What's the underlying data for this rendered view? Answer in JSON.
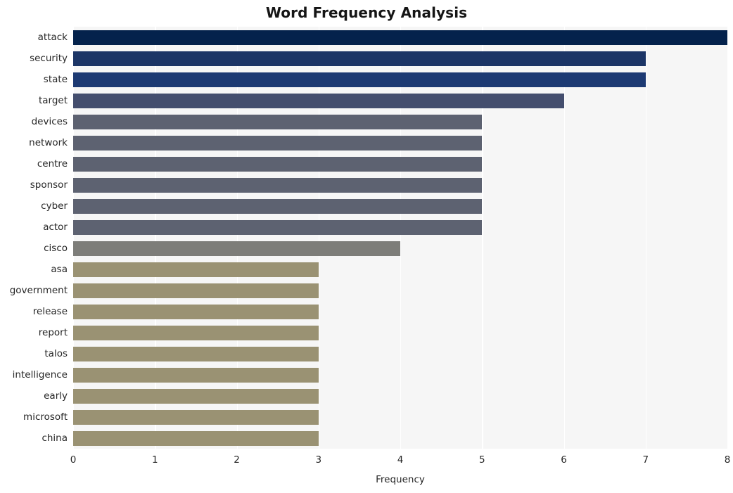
{
  "chart_data": {
    "type": "bar",
    "orientation": "horizontal",
    "title": "Word Frequency Analysis",
    "xlabel": "Frequency",
    "ylabel": "",
    "xlim": [
      0,
      8
    ],
    "xticks": [
      "0",
      "1",
      "2",
      "3",
      "4",
      "5",
      "6",
      "7",
      "8"
    ],
    "xtick_values": [
      0,
      1,
      2,
      3,
      4,
      5,
      6,
      7,
      8
    ],
    "grid": "vertical-white-on-lightgrey",
    "legend": "none",
    "plot_background": "#f6f6f6",
    "categories": [
      "attack",
      "security",
      "state",
      "target",
      "devices",
      "network",
      "centre",
      "sponsor",
      "cyber",
      "actor",
      "cisco",
      "asa",
      "government",
      "release",
      "report",
      "talos",
      "intelligence",
      "early",
      "microsoft",
      "china"
    ],
    "values": [
      8,
      7,
      7,
      6,
      5,
      5,
      5,
      5,
      5,
      5,
      4,
      3,
      3,
      3,
      3,
      3,
      3,
      3,
      3,
      3
    ],
    "bar_colors": [
      "#032košt"
    ],
    "colors": [
      "#04224c",
      "#1c3566",
      "#1d3a73",
      "#444e6e",
      "#5d6271",
      "#5d6271",
      "#5d6271",
      "#5d6271",
      "#5d6271",
      "#5d6271",
      "#7d7d79",
      "#9a9273",
      "#9a9273",
      "#9a9273",
      "#9a9273",
      "#9a9273",
      "#9a9273",
      "#9a9273",
      "#9a9273",
      "#9a9273"
    ]
  }
}
